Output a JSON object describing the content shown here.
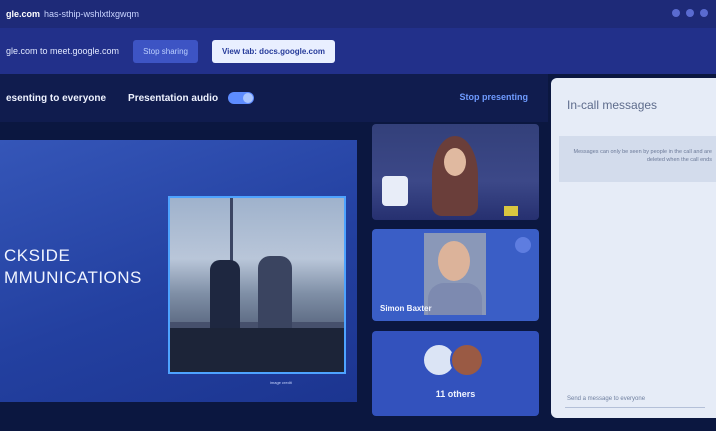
{
  "browser": {
    "url_strong": "gle.com",
    "url_rest": "has-sthip-wshlxtlxgwqm"
  },
  "share_bar": {
    "sharing_text": "gle.com to meet.google.com",
    "stop_sharing_label": "Stop sharing",
    "view_tab_label": "View tab: docs.google.com"
  },
  "meet_bar": {
    "presenting_label": "esenting to everyone",
    "audio_label": "Presentation audio",
    "stop_presenting_label": "Stop presenting"
  },
  "slide": {
    "title_line1": "CKSIDE",
    "title_line2": "MMUNICATIONS",
    "caption": "image credit"
  },
  "participants": {
    "tile2_name": "Simon Baxter",
    "others_label": "11 others"
  },
  "chat_panel": {
    "title": "In-call messages",
    "notice": "Messages can only be seen by people in the call and are deleted when the call ends",
    "input_placeholder": "Send a message to everyone"
  },
  "colors": {
    "accent_blue": "#4ea3ff",
    "panel_bg": "#e6ecf7",
    "topbar_bg": "#1e2a78"
  }
}
